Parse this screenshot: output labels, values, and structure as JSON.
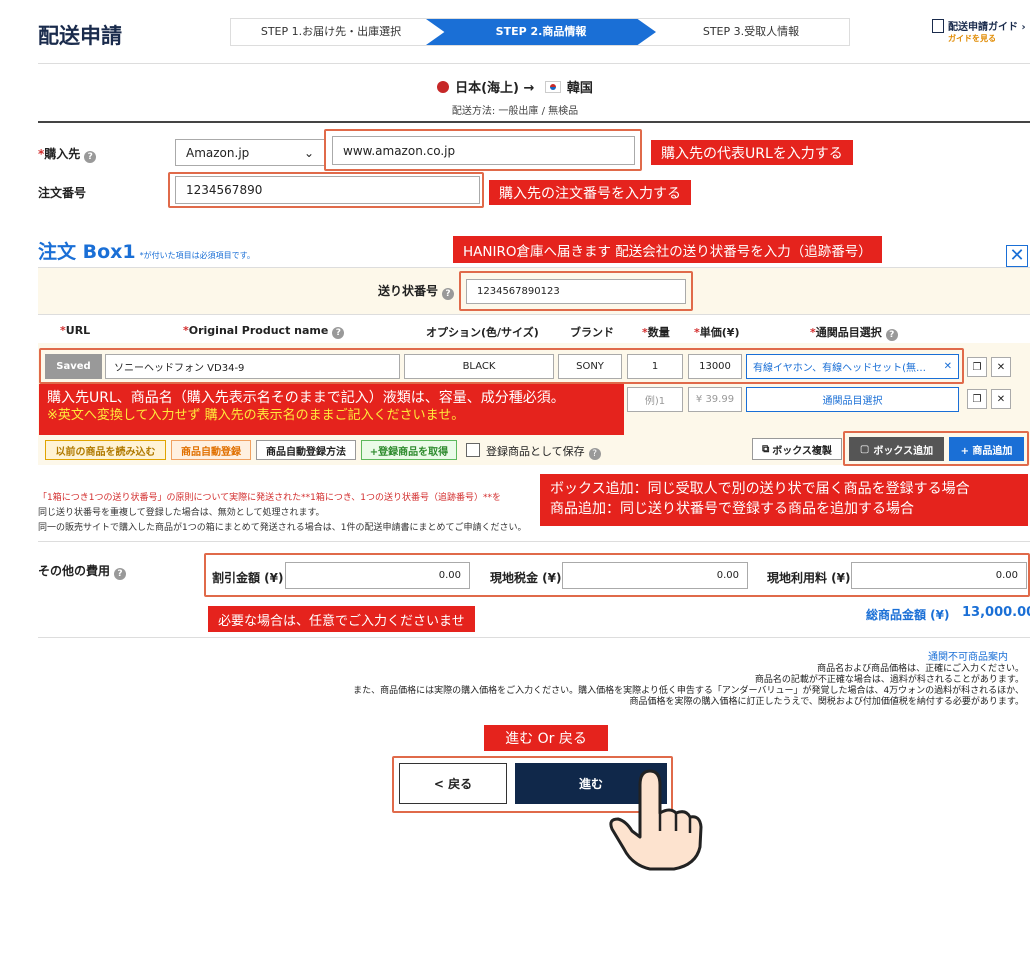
{
  "header": {
    "title": "配送申請",
    "steps": [
      "STEP 1.お届け先・出庫選択",
      "STEP 2.商品情報",
      "STEP 3.受取人情報"
    ],
    "guide_label": "配送申請ガイド",
    "guide_sub": "ガイドを見る"
  },
  "route": {
    "from": "日本(海上)",
    "arrow": "→",
    "to": "韓国",
    "method": "配送方法: 一般出庫 / 無検品"
  },
  "purchase": {
    "store_label": "購入先",
    "store_select": "Amazon.jp",
    "store_url": "www.amazon.co.jp",
    "order_label": "注文番号",
    "order_value": "1234567890",
    "note_url": "購入先の代表URLを入力する",
    "note_order": "購入先の注文番号を入力する"
  },
  "box": {
    "title": "注文 Box1",
    "title_note": "*が付いた項目は必須項目です。",
    "note_tracking": "HANIRO倉庫へ届きます 配送会社の送り状番号を入力（追跡番号）",
    "tracking_label": "送り状番号",
    "tracking_value": "1234567890123",
    "columns": [
      "URL",
      "Original Product name",
      "オプション(色/サイズ)",
      "ブランド",
      "数量",
      "単価(¥)",
      "通関品目選択"
    ],
    "row1": {
      "status": "Saved",
      "name": "ソニーヘッドフォン VD34-9",
      "option": "BLACK",
      "brand": "SONY",
      "qty": "1",
      "price": "13000",
      "category": "有線イヤホン、有線ヘッドセット(無…"
    },
    "row2": {
      "qty_placeholder": "例)1",
      "price_placeholder": "¥ 39.99",
      "category_btn": "通関品目選択"
    },
    "note_product_1": "購入先URL、商品名（購入先表示名そのままで記入）液類は、容量、成分種必須。",
    "note_product_2": "※英文へ変換して入力せず 購入先の表示名のままご記入くださいませ。",
    "buttons": {
      "load_prev": "以前の商品を読み込む",
      "auto_register": "商品自動登録",
      "auto_howto": "商品自動登録方法",
      "get_registered": "+登録商品を取得",
      "save_as": "登録商品として保存",
      "copy_box": "ボックス複製",
      "add_box": "ボックス追加",
      "add_product": "+ 商品追加"
    },
    "note_add_1": "ボックス追加：同じ受取人で別の送り状で届く商品を登録する場合",
    "note_add_2": "商品追加：同じ送り状番号で登録する商品を追加する場合",
    "info_1": "「1箱につき1つの送り状番号」の原則について実際に発送された**1箱につき、1つの送り状番号（追跡番号）**を",
    "info_2": "同じ送り状番号を重複して登録した場合は、無効として処理されます。",
    "info_3": "同一の販売サイトで購入した商品が1つの箱にまとめて発送される場合は、1件の配送申請書にまとめてご申請ください。"
  },
  "fees": {
    "label": "その他の費用",
    "discount_label": "割引金額 (¥)",
    "discount": "0.00",
    "tax_label": "現地税金 (¥)",
    "tax": "0.00",
    "usage_label": "現地利用料 (¥)",
    "usage": "0.00",
    "note": "必要な場合は、任意でご入力くださいませ",
    "total_label": "総商品金額 (¥)",
    "total": "13,000.00"
  },
  "footer": {
    "link": "通関不可商品案内",
    "l1": "商品名および商品価格は、正確にご入力ください。",
    "l2": "商品名の記載が不正確な場合は、過料が科されることがあります。",
    "l3": "また、商品価格には実際の購入価格をご入力ください。購入価格を実際より低く申告する「アンダーバリュー」が発覚した場合は、4万ウォンの過料が科されるほか、",
    "l4": "商品価格を実際の購入価格に訂正したうえで、関税および付加価値税を納付する必要があります。"
  },
  "nav": {
    "note": "進む Or 戻る",
    "back": "< 戻る",
    "next": "進む"
  },
  "colors": {
    "accent": "#1a6fd6",
    "note_red": "#e5231d",
    "navy": "#10284a"
  }
}
